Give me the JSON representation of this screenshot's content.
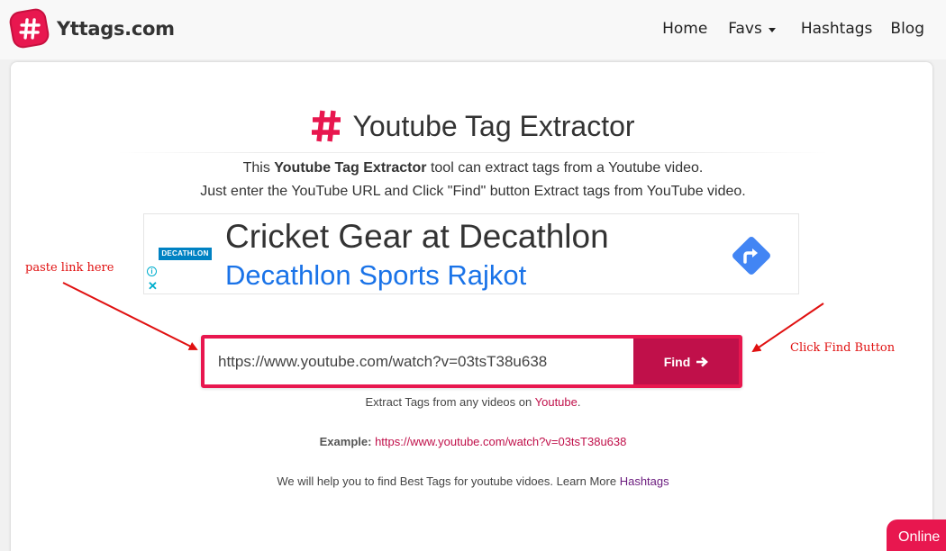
{
  "navbar": {
    "brand": "Yttags.com",
    "items": [
      {
        "label": "Home"
      },
      {
        "label": "Favs"
      },
      {
        "label": "Hashtags"
      },
      {
        "label": "Blog"
      }
    ]
  },
  "main": {
    "title": "Youtube Tag Extractor",
    "desc1_pre": "This ",
    "desc1_bold": "Youtube Tag Extractor",
    "desc1_post": " tool can extract tags from a Youtube video.",
    "desc2": "Just enter the YouTube URL and Click \"Find\" button Extract tags from YouTube video."
  },
  "ad": {
    "logo_text": "DECATHLON",
    "title": "Cricket Gear at Decathlon",
    "subtitle": "Decathlon Sports Rajkot",
    "info_icon": "info-icon",
    "close_icon": "close-icon",
    "directions_icon": "directions-icon"
  },
  "search": {
    "value": "https://www.youtube.com/watch?v=03tsT38u638",
    "button_label": "Find"
  },
  "hints": {
    "line1_pre": "Extract Tags from any videos on ",
    "line1_link": "Youtube",
    "line1_post": ".",
    "example_label": "Example:",
    "example_url": "https://www.youtube.com/watch?v=03tsT38u638",
    "line3_pre": "We will help you to find Best Tags for youtube vidoes. Learn More ",
    "line3_link": "Hashtags"
  },
  "annotations": {
    "left": "paste link here",
    "right": "Click Find Button"
  },
  "status": {
    "online": "Online"
  },
  "colors": {
    "accent": "#e8174f",
    "button": "#c0104a",
    "ad_blue": "#1a73e8",
    "annotation_red": "#e01010"
  }
}
